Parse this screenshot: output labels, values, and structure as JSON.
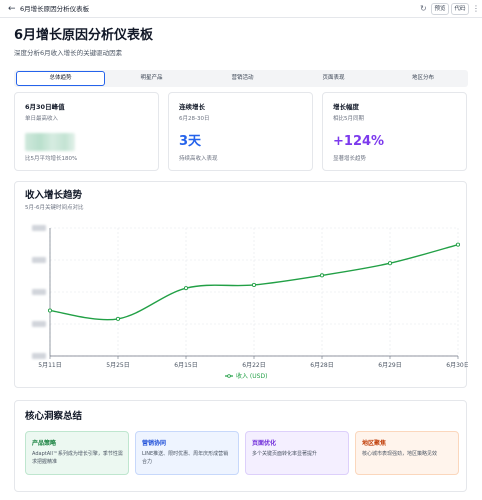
{
  "app": {
    "title": "6月增长原因分析仪表板",
    "back_icon": "arrow-left-icon",
    "refresh_icon": "refresh-icon",
    "preview_label": "预览",
    "code_label": "代码",
    "more_icon": "more-vertical-icon"
  },
  "header": {
    "title": "6月增长原因分析仪表板",
    "subtitle": "深度分析6月收入增长的关键驱动因素"
  },
  "tabs": [
    {
      "label": "总体趋势",
      "active": true
    },
    {
      "label": "明星产品",
      "active": false
    },
    {
      "label": "营销活动",
      "active": false
    },
    {
      "label": "页面表现",
      "active": false
    },
    {
      "label": "地区分布",
      "active": false
    }
  ],
  "kpis": [
    {
      "title": "6月30日峰值",
      "subtitle": "单日最高收入",
      "value": "",
      "value_blurred": true,
      "note": "比5月平均增长180%",
      "color": "#111827"
    },
    {
      "title": "连续增长",
      "subtitle": "6月28-30日",
      "value": "3天",
      "note": "持续高收入表现",
      "color": "#2563eb"
    },
    {
      "title": "增长幅度",
      "subtitle": "相比5月同期",
      "value": "+124%",
      "note": "显著增长趋势",
      "color": "#7c3aed"
    }
  ],
  "trend": {
    "title": "收入增长趋势",
    "subtitle": "5月-6月关键时间点对比"
  },
  "chart_data": {
    "type": "line",
    "x": [
      "5月11日",
      "5月25日",
      "6月15日",
      "6月22日",
      "6月28日",
      "6月29日",
      "6月30日"
    ],
    "series": [
      {
        "name": "收入 (USD)",
        "values": [
          0.71,
          0.58,
          1.06,
          1.11,
          1.26,
          1.45,
          1.74
        ],
        "color": "#22a046"
      }
    ],
    "y_tick_labels_blurred": true,
    "ylim": [
      0,
      2.0
    ],
    "grid": true,
    "legend": "bottom"
  },
  "insights": {
    "title": "核心洞察总结",
    "cards": [
      {
        "head": "产品策略",
        "body": "AdaptAll™系列成为增长引擎，季节性需求把握精准",
        "bg": "#ecf8f1",
        "border": "#bfe6cf",
        "color": "#15803d"
      },
      {
        "head": "营销协同",
        "body": "LINE推送、限时优惠、周年庆形成营销合力",
        "bg": "#eef4ff",
        "border": "#c7d8fb",
        "color": "#1d4ed8"
      },
      {
        "head": "页面优化",
        "body": "多个关键页面转化率显著提升",
        "bg": "#f4efff",
        "border": "#ddd0fb",
        "color": "#6d28d9"
      },
      {
        "head": "地区聚焦",
        "body": "核心城市表现强劲，地区策略见效",
        "bg": "#fff4ec",
        "border": "#fbd7bd",
        "color": "#c2410c"
      }
    ]
  }
}
